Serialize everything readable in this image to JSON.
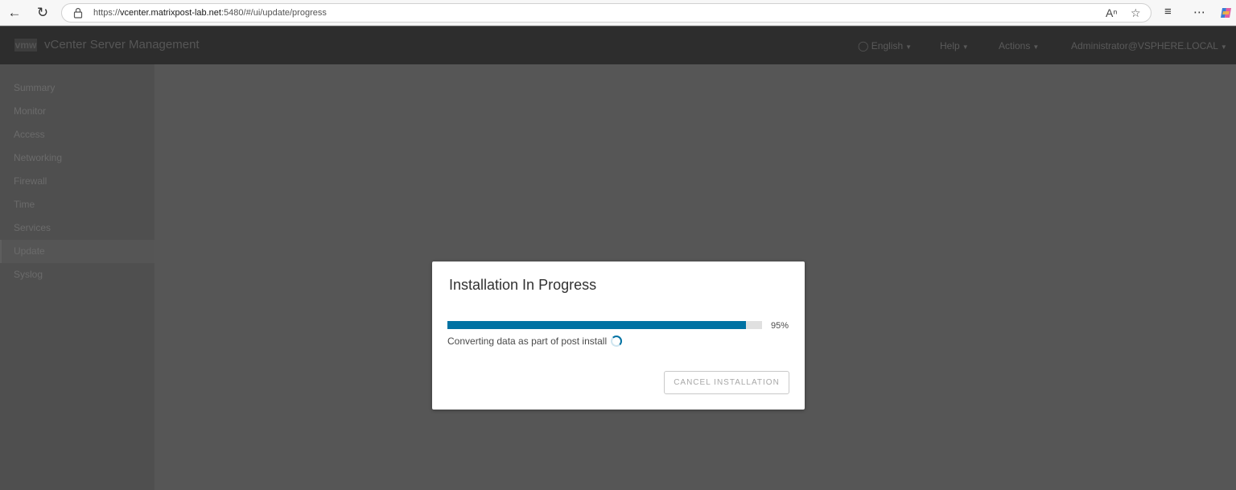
{
  "browser": {
    "url_scheme": "https://",
    "url_host": "vcenter.matrixpost-lab.net",
    "url_rest": ":5480/#/ui/update/progress"
  },
  "header": {
    "logo": "vmw",
    "title": "vCenter Server Management",
    "language": "English",
    "help": "Help",
    "actions": "Actions",
    "user": "Administrator@VSPHERE.LOCAL"
  },
  "sidebar": {
    "items": [
      {
        "label": "Summary"
      },
      {
        "label": "Monitor"
      },
      {
        "label": "Access"
      },
      {
        "label": "Networking"
      },
      {
        "label": "Firewall"
      },
      {
        "label": "Time"
      },
      {
        "label": "Services"
      },
      {
        "label": "Update",
        "active": true
      },
      {
        "label": "Syslog"
      }
    ]
  },
  "modal": {
    "title": "Installation In Progress",
    "progress_percent": 95,
    "progress_label": "95%",
    "status_text": "Converting data as part of post install",
    "cancel_label": "CANCEL INSTALLATION"
  },
  "colors": {
    "accent": "#0072a3",
    "header_bg": "#2d2d2d",
    "overlay": "#565656"
  }
}
